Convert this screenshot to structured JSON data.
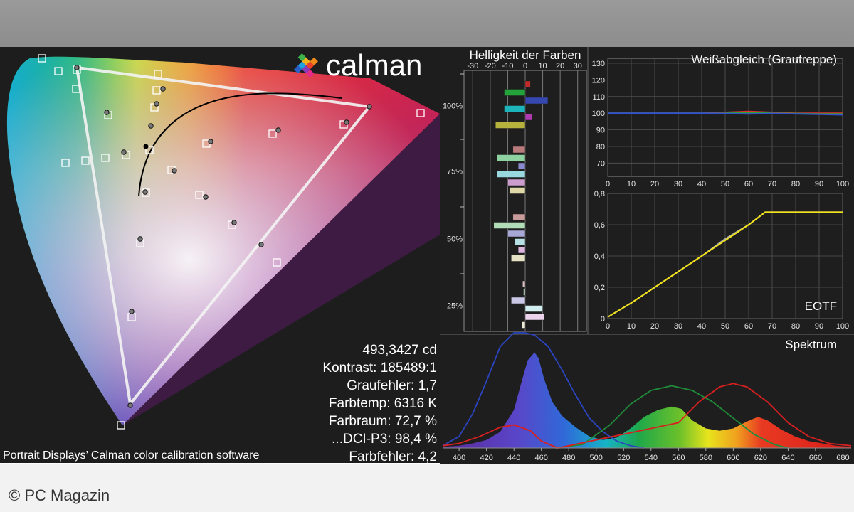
{
  "brand": {
    "logo_text": "calman"
  },
  "cie": {
    "stats": [
      "493,3427 cd",
      "Kontrast: 185489:1",
      "Graufehler: 1,7",
      "Farbtemp: 6316 K",
      "Farbraum: 72,7 %",
      "...DCI-P3: 98,4 %",
      "Farbfehler: 4,2"
    ],
    "caption": "Portrait Displays’ Calman color calibration software"
  },
  "credit": "© PC Magazin",
  "chart_data": [
    {
      "type": "bar",
      "title": "Helligkeit der Farben",
      "x_ticks": [
        "-30",
        "-20",
        "-10",
        "0",
        "10",
        "20",
        "30"
      ],
      "xlim": [
        -35,
        35
      ],
      "y_labels": [
        "100%",
        "75%",
        "50%",
        "25%"
      ],
      "groups": [
        {
          "level": "100%",
          "bars": [
            {
              "color": "#c42a2a",
              "value": 3
            },
            {
              "color": "#23a33a",
              "value": -12
            },
            {
              "color": "#3648b0",
              "value": 13
            },
            {
              "color": "#1db5bb",
              "value": -12
            },
            {
              "color": "#b03bb0",
              "value": 4
            },
            {
              "color": "#b6b23e",
              "value": -17
            }
          ]
        },
        {
          "level": "75%",
          "bars": [
            {
              "color": "#b87a7a",
              "value": -7
            },
            {
              "color": "#8fd2a2",
              "value": -16
            },
            {
              "color": "#8a8ad0",
              "value": -4
            },
            {
              "color": "#98d8de",
              "value": -16
            },
            {
              "color": "#cc9ccc",
              "value": -10
            },
            {
              "color": "#ded8a8",
              "value": -9
            }
          ]
        },
        {
          "level": "50%",
          "bars": [
            {
              "color": "#c89a9a",
              "value": -7
            },
            {
              "color": "#b0dcb8",
              "value": -18
            },
            {
              "color": "#a8a8d6",
              "value": -10
            },
            {
              "color": "#b6e0e3",
              "value": -6
            },
            {
              "color": "#dcb6dc",
              "value": -4
            },
            {
              "color": "#e6e2c4",
              "value": -8
            }
          ]
        },
        {
          "level": "25%",
          "bars": [
            {
              "color": "#d8c0c0",
              "value": -1.5
            },
            {
              "color": "#cce8d2",
              "value": -1
            },
            {
              "color": "#c8c8e6",
              "value": -8
            },
            {
              "color": "#d2eef0",
              "value": 10
            },
            {
              "color": "#ecd4ec",
              "value": 11
            },
            {
              "color": "#efecd8",
              "value": -2
            }
          ]
        }
      ]
    },
    {
      "type": "line",
      "title": "Weißabgleich (Grautreppe)",
      "x_ticks": [
        "0",
        "10",
        "20",
        "30",
        "40",
        "50",
        "60",
        "70",
        "80",
        "90",
        "100"
      ],
      "y_ticks": [
        "70",
        "80",
        "90",
        "100",
        "110",
        "120",
        "130"
      ],
      "xlim": [
        0,
        100
      ],
      "ylim": [
        62,
        133
      ],
      "series": [
        {
          "color": "#e03030",
          "x": [
            0,
            10,
            20,
            30,
            40,
            50,
            60,
            70,
            80,
            90,
            100
          ],
          "y": [
            100,
            100,
            100,
            100,
            100,
            100.5,
            101,
            100.5,
            100,
            100,
            100
          ]
        },
        {
          "color": "#30a030",
          "x": [
            0,
            10,
            20,
            30,
            40,
            50,
            60,
            70,
            80,
            90,
            100
          ],
          "y": [
            100,
            100,
            100,
            100,
            100,
            100,
            100.5,
            100,
            99.8,
            99.5,
            99.5
          ]
        },
        {
          "color": "#3050d0",
          "x": [
            0,
            10,
            20,
            30,
            40,
            50,
            60,
            70,
            80,
            90,
            100
          ],
          "y": [
            100,
            100,
            100,
            100,
            100,
            99.8,
            99.5,
            99.8,
            99.6,
            99.3,
            99
          ]
        }
      ]
    },
    {
      "type": "line",
      "title": "EOTF",
      "x_ticks": [
        "0",
        "10",
        "20",
        "30",
        "40",
        "50",
        "60",
        "70",
        "80",
        "90",
        "100"
      ],
      "y_ticks": [
        "0",
        "0,2",
        "0,4",
        "0,6",
        "0,8"
      ],
      "xlim": [
        0,
        100
      ],
      "ylim": [
        0,
        0.8
      ],
      "series": [
        {
          "color": "#aaaaaa",
          "x": [
            0,
            10,
            20,
            30,
            40,
            50,
            60,
            67,
            70,
            100
          ],
          "y": [
            0.01,
            0.1,
            0.2,
            0.3,
            0.4,
            0.51,
            0.6,
            0.68,
            0.68,
            0.68
          ]
        },
        {
          "color": "#f2e21a",
          "x": [
            0,
            10,
            20,
            30,
            40,
            50,
            60,
            67,
            70,
            100
          ],
          "y": [
            0.01,
            0.1,
            0.2,
            0.3,
            0.4,
            0.5,
            0.6,
            0.68,
            0.68,
            0.68
          ]
        }
      ]
    },
    {
      "type": "area",
      "title": "Spektrum",
      "x_ticks": [
        "400",
        "420",
        "440",
        "460",
        "480",
        "500",
        "520",
        "540",
        "560",
        "580",
        "600",
        "620",
        "640",
        "660",
        "680"
      ],
      "xlim": [
        388,
        686
      ],
      "ylim": [
        0,
        1
      ],
      "measured": {
        "x": [
          388,
          400,
          410,
          420,
          430,
          440,
          445,
          450,
          455,
          458,
          462,
          468,
          475,
          485,
          495,
          505,
          515,
          525,
          535,
          545,
          555,
          562,
          570,
          580,
          590,
          600,
          610,
          618,
          625,
          635,
          645,
          655,
          665,
          675,
          686
        ],
        "y": [
          0.01,
          0.02,
          0.04,
          0.07,
          0.14,
          0.33,
          0.55,
          0.76,
          0.83,
          0.78,
          0.6,
          0.4,
          0.28,
          0.18,
          0.1,
          0.07,
          0.09,
          0.17,
          0.27,
          0.33,
          0.36,
          0.34,
          0.24,
          0.17,
          0.15,
          0.17,
          0.23,
          0.27,
          0.24,
          0.16,
          0.1,
          0.06,
          0.04,
          0.02,
          0.01
        ]
      },
      "series": [
        {
          "color": "#2b45c0",
          "x": [
            388,
            400,
            410,
            420,
            430,
            440,
            448,
            455,
            465,
            475,
            485,
            495,
            505,
            515,
            525,
            535
          ],
          "y": [
            0.02,
            0.1,
            0.3,
            0.58,
            0.88,
            1.0,
            1.0,
            0.98,
            0.88,
            0.68,
            0.46,
            0.26,
            0.14,
            0.06,
            0.02,
            0.0
          ]
        },
        {
          "color": "#1f8c3a",
          "x": [
            470,
            490,
            510,
            525,
            540,
            555,
            570,
            585,
            600,
            615,
            630,
            640
          ],
          "y": [
            0.0,
            0.03,
            0.2,
            0.38,
            0.5,
            0.54,
            0.5,
            0.4,
            0.26,
            0.12,
            0.03,
            0.0
          ]
        },
        {
          "color": "#d82020",
          "x": [
            388,
            400,
            415,
            430,
            440,
            452,
            460,
            472,
            560,
            575,
            590,
            600,
            610,
            625,
            640,
            655,
            670,
            686
          ],
          "y": [
            0.02,
            0.04,
            0.1,
            0.18,
            0.2,
            0.15,
            0.06,
            0.0,
            0.22,
            0.4,
            0.53,
            0.56,
            0.53,
            0.4,
            0.22,
            0.1,
            0.04,
            0.02
          ]
        }
      ]
    }
  ]
}
